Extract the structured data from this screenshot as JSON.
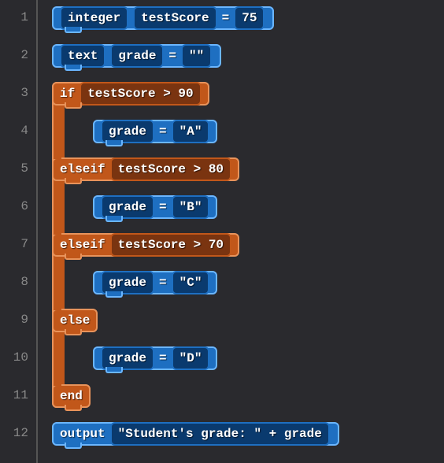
{
  "gutter": [
    "1",
    "2",
    "3",
    "4",
    "5",
    "6",
    "7",
    "8",
    "9",
    "10",
    "11",
    "12"
  ],
  "lines": {
    "l1": {
      "type": "integer",
      "var": "testScore",
      "eq": "=",
      "val": "75"
    },
    "l2": {
      "type": "text",
      "var": "grade",
      "eq": "=",
      "val": "\"\""
    },
    "l3": {
      "kw": "if",
      "cond": "testScore > 90"
    },
    "l4": {
      "var": "grade",
      "eq": "=",
      "val": "\"A\""
    },
    "l5": {
      "kw": "elseif",
      "cond": "testScore > 80"
    },
    "l6": {
      "var": "grade",
      "eq": "=",
      "val": "\"B\""
    },
    "l7": {
      "kw": "elseif",
      "cond": "testScore > 70"
    },
    "l8": {
      "var": "grade",
      "eq": "=",
      "val": "\"C\""
    },
    "l9": {
      "kw": "else"
    },
    "l10": {
      "var": "grade",
      "eq": "=",
      "val": "\"D\""
    },
    "l11": {
      "kw": "end"
    },
    "l12": {
      "kw": "output",
      "expr": "\"Student's grade: \" + grade"
    }
  }
}
